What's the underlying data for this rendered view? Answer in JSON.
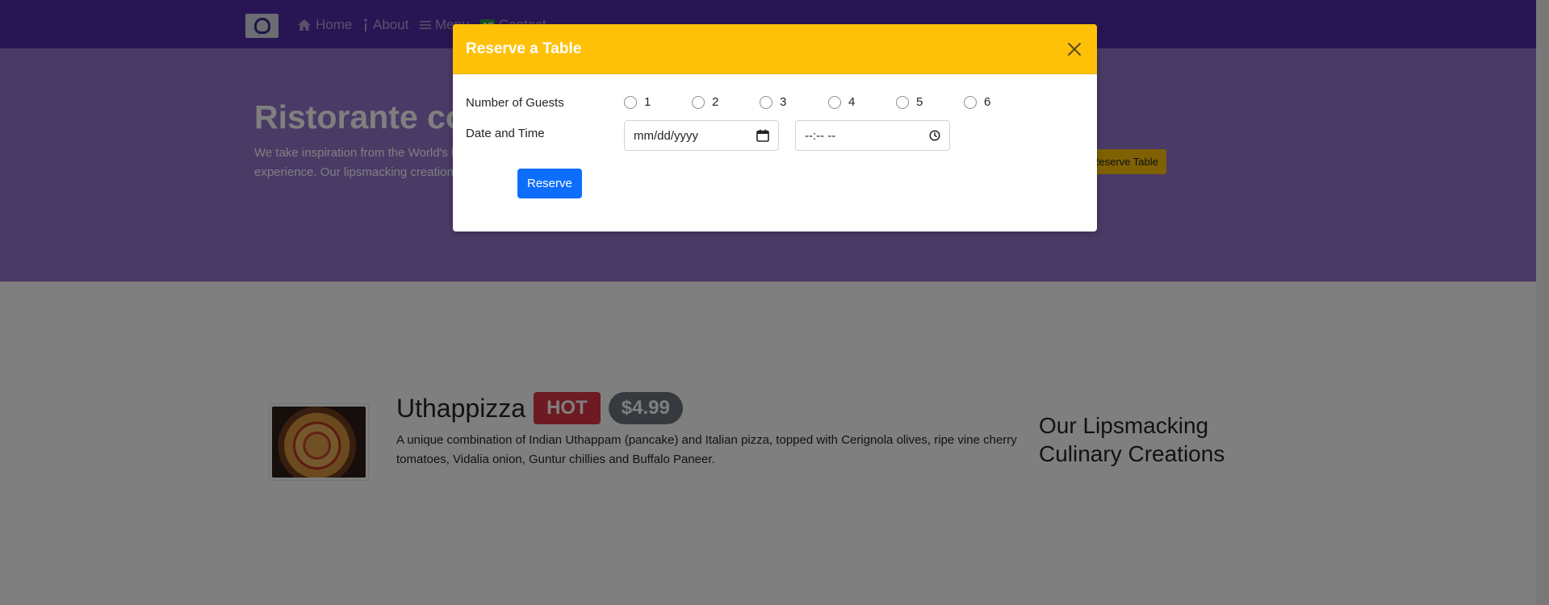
{
  "nav": {
    "items": [
      {
        "label": "Home",
        "icon": "home-icon"
      },
      {
        "label": "About",
        "icon": "info-icon"
      },
      {
        "label": "Menu",
        "icon": "list-icon"
      },
      {
        "label": "Contact",
        "icon": "address-card-icon"
      }
    ]
  },
  "hero": {
    "title": "Ristorante con Fusion",
    "text_line1": "We take inspiration from the World's best cuisines, and create a unique fusion",
    "text_line2": "experience. Our lipsmacking creations will tickle your culinary senses!",
    "button_label": "Reserve Table"
  },
  "dish": {
    "name": "Uthappizza",
    "badge_hot": "HOT",
    "price": "$4.99",
    "description": "A unique combination of Indian Uthappam (pancake) and Italian pizza, topped with Cerignola olives, ripe vine cherry tomatoes, Vidalia onion, Guntur chillies and Buffalo Paneer."
  },
  "side": {
    "heading": "Our Lipsmacking Culinary Creations"
  },
  "modal": {
    "title": "Reserve a Table",
    "guests_label": "Number of Guests",
    "guest_options": [
      "1",
      "2",
      "3",
      "4",
      "5",
      "6"
    ],
    "datetime_label": "Date and Time",
    "date_placeholder": "mm/dd/yyyy",
    "time_placeholder": "--:-- --",
    "reserve_label": "Reserve"
  },
  "colors": {
    "navbar": "#512da8",
    "jumbotron": "#9575cd",
    "modal_header": "#ffc107",
    "primary": "#0d6efd",
    "danger": "#dc3545",
    "secondary": "#6c757d"
  }
}
